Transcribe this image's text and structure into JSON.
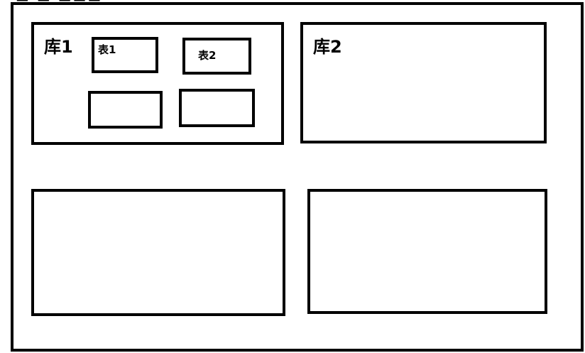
{
  "diagram": {
    "db1": {
      "label": "库1",
      "tables": [
        {
          "label": "表1"
        },
        {
          "label": "表2"
        },
        {
          "label": ""
        },
        {
          "label": ""
        }
      ]
    },
    "db2": {
      "label": "库2"
    },
    "db3": {
      "label": ""
    },
    "db4": {
      "label": ""
    }
  }
}
